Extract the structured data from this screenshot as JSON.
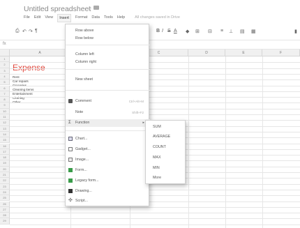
{
  "title": "Untitled spreadsheet",
  "star": "☆",
  "menubar": [
    "File",
    "Edit",
    "View",
    "Insert",
    "Format",
    "Data",
    "Tools",
    "Help"
  ],
  "save_status": "All changes saved in Drive",
  "formula_label": "fx",
  "columns": [
    "A",
    "B",
    "C",
    "D",
    "E",
    "F"
  ],
  "rows": [
    "1",
    "2",
    "3",
    "4",
    "5",
    "6",
    "7",
    "8",
    "9",
    "10",
    "11",
    "12",
    "13",
    "14",
    "15",
    "16",
    "17",
    "18",
    "19",
    "20",
    "21",
    "22",
    "23",
    "24",
    "25",
    "26",
    "27",
    "28",
    "29"
  ],
  "sheet": {
    "heading": "Expense",
    "items": [
      "Rent",
      "Car repairs",
      "Groceries",
      "Cleaning items",
      "Entertainment",
      "Clothing",
      "Other"
    ]
  },
  "insert_menu": {
    "row_above": "Row above",
    "row_below": "Row below",
    "col_left": "Column left",
    "col_right": "Column right",
    "new_sheet": "New sheet",
    "comment": "Comment",
    "comment_sc": "Ctrl+Alt+M",
    "note": "Note",
    "note_sc": "Shift+F2",
    "function": "Function",
    "chart": "Chart...",
    "gadget": "Gadget...",
    "image": "Image...",
    "form": "Form...",
    "legacy_form": "Legacy form...",
    "drawing": "Drawing...",
    "script": "Script..."
  },
  "function_menu": [
    "SUM",
    "AVERAGE",
    "COUNT",
    "MAX",
    "MIN",
    "More"
  ]
}
